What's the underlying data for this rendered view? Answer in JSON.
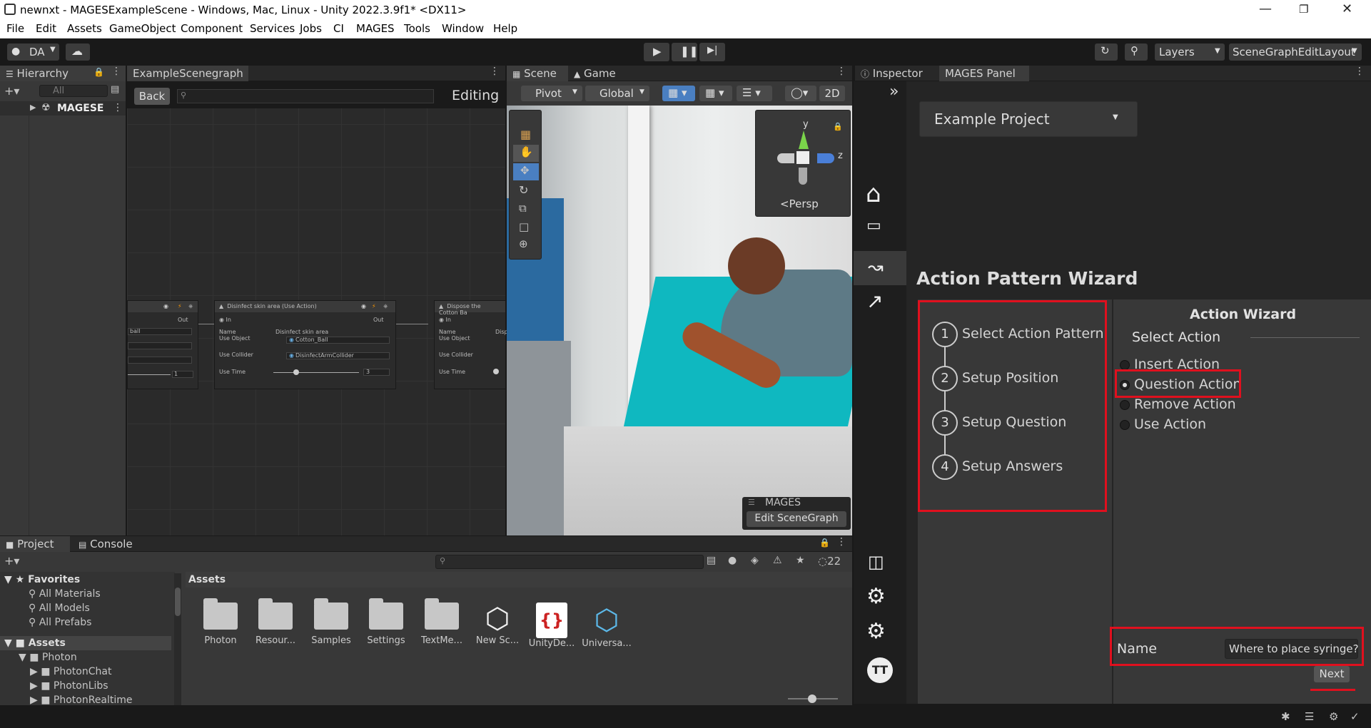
{
  "window": {
    "title": "newnxt - MAGESExampleScene - Windows, Mac, Linux - Unity 2022.3.9f1* <DX11>"
  },
  "menu": [
    "File",
    "Edit",
    "Assets",
    "GameObject",
    "Component",
    "Services",
    "Jobs",
    "CI",
    "MAGES",
    "Tools",
    "Window",
    "Help"
  ],
  "toolbar": {
    "account": "DA",
    "layers": "Layers",
    "layout": "SceneGraphEditLayout"
  },
  "hierarchy": {
    "tab": "Hierarchy",
    "search_placeholder": "All",
    "item": "MAGESE"
  },
  "scenegraph": {
    "tab": "ExampleScenegraph",
    "back": "Back",
    "mode": "Editing",
    "node_left": {
      "out": "Out",
      "f1": "ball",
      "time_val": "1"
    },
    "node_mid": {
      "title": "Disinfect skin area (Use Action)",
      "in": "In",
      "out": "Out",
      "name_label": "Name",
      "name_val": "Disinfect skin area",
      "useobj_label": "Use Object",
      "useobj_val": "Cotton_Ball",
      "usecol_label": "Use Collider",
      "usecol_val": "DisinfectArmCollider",
      "usetime_label": "Use Time",
      "usetime_val": "3"
    },
    "node_right": {
      "title": "Dispose the Cotton Ba",
      "in": "In",
      "name_label": "Name",
      "name_val": "Disp",
      "useobj_label": "Use Object",
      "usecol_label": "Use Collider",
      "usetime_label": "Use Time"
    }
  },
  "scene": {
    "tab_scene": "Scene",
    "tab_game": "Game",
    "pivot": "Pivot",
    "global": "Global",
    "two_d": "2D",
    "persp": "Persp",
    "axis_y": "y",
    "axis_z": "z",
    "mages_label": "MAGES",
    "edit_btn": "Edit SceneGraph"
  },
  "inspector": {
    "tab": "Inspector",
    "mages_tab": "MAGES Panel"
  },
  "mages": {
    "project": "Example Project",
    "wizard_title": "Action Pattern Wizard",
    "steps": [
      {
        "n": "1",
        "label": "Select Action Pattern"
      },
      {
        "n": "2",
        "label": "Setup Position"
      },
      {
        "n": "3",
        "label": "Setup Question"
      },
      {
        "n": "4",
        "label": "Setup Answers"
      }
    ],
    "action_wizard": "Action Wizard",
    "select_action": "Select Action",
    "options": [
      "Insert Action",
      "Question Action",
      "Remove Action",
      "Use Action"
    ],
    "selected_option": "Question Action",
    "name_label": "Name",
    "name_value": "Where to place syringe?",
    "next": "Next",
    "avatar": "TT"
  },
  "project": {
    "tab_project": "Project",
    "tab_console": "Console",
    "hidden_count": "22",
    "favorites": "Favorites",
    "fav_items": [
      "All Materials",
      "All Models",
      "All Prefabs"
    ],
    "assets_root": "Assets",
    "tree": [
      "Photon",
      "PhotonChat",
      "PhotonLibs",
      "PhotonRealtime"
    ],
    "assets_header": "Assets",
    "assets": [
      "Photon",
      "Resour...",
      "Samples",
      "Settings",
      "TextMe...",
      "New Sc...",
      "UnityDe...",
      "Universa..."
    ]
  },
  "colors": {
    "highlight_red": "#e0101e",
    "accent_blue": "#4a7fc1"
  }
}
